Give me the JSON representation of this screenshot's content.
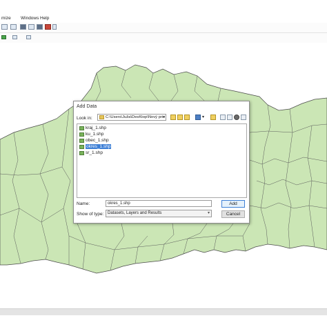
{
  "menu": {
    "items": [
      "mize",
      "Windows",
      "Help"
    ]
  },
  "dialog": {
    "title": "Add Data",
    "look_in_label": "Look in:",
    "look_in_path": "C:\\Users\\Juža\\DesKtop\\Nový prie",
    "files": [
      "kraj_1.shp",
      "ku_1.shp",
      "obec_1.shp",
      "okres_1.shp",
      "sr_1.shp"
    ],
    "selected_file": "okres_1.shp",
    "name_label": "Name:",
    "name_value": "okres_1.shp",
    "show_type_label": "Show of type:",
    "show_type_value": "Datasets, Layers and Results",
    "add_label": "Add",
    "cancel_label": "Cancel"
  },
  "colors": {
    "map_fill": "#cbe6b5",
    "map_stroke": "#4a4a4a",
    "selection": "#3d7fd6"
  }
}
